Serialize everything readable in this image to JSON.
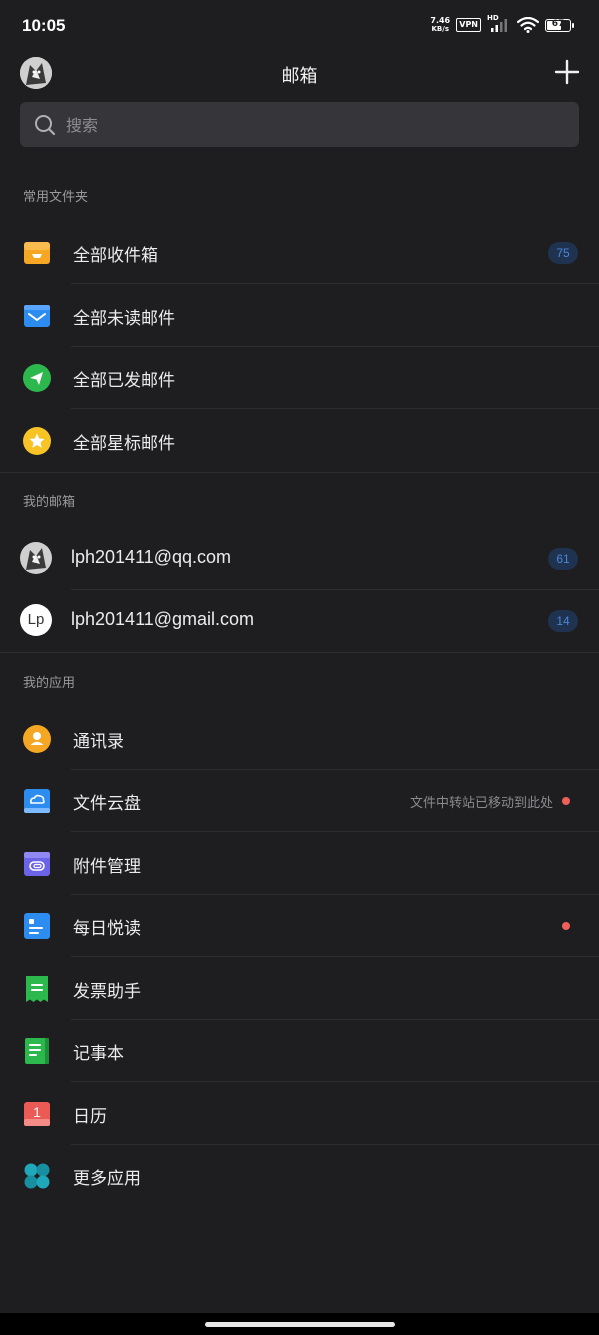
{
  "status_bar": {
    "time": "10:05",
    "net_speed_value": "7.46",
    "net_speed_unit": "KB/s",
    "vpn": "VPN",
    "hd": "HD",
    "battery": "67",
    "battery_level": 0.67
  },
  "header": {
    "title": "邮箱",
    "add_icon": "plus-icon",
    "avatar_icon": "user-avatar"
  },
  "search": {
    "placeholder": "搜索",
    "icon": "search-icon"
  },
  "sections": {
    "common_folders": "常用文件夹",
    "my_mailboxes": "我的邮箱",
    "my_apps": "我的应用"
  },
  "common_folders": [
    {
      "label": "全部收件箱",
      "icon": "inbox-icon",
      "badge": "75"
    },
    {
      "label": "全部未读邮件",
      "icon": "unread-mail-icon"
    },
    {
      "label": "全部已发邮件",
      "icon": "sent-icon"
    },
    {
      "label": "全部星标邮件",
      "icon": "star-icon"
    }
  ],
  "mailboxes": [
    {
      "label": "lph201411@qq.com",
      "badge": "61",
      "avatar": "user-avatar"
    },
    {
      "label": "lph201411@gmail.com",
      "badge": "14",
      "avatar_text": "Lp"
    }
  ],
  "apps": [
    {
      "label": "通讯录",
      "icon": "contacts-icon"
    },
    {
      "label": "文件云盘",
      "icon": "cloud-drive-icon",
      "hint": "文件中转站已移动到此处",
      "dot": true
    },
    {
      "label": "附件管理",
      "icon": "attachment-icon"
    },
    {
      "label": "每日悦读",
      "icon": "daily-read-icon",
      "dot": true
    },
    {
      "label": "发票助手",
      "icon": "invoice-icon"
    },
    {
      "label": "记事本",
      "icon": "notebook-icon"
    },
    {
      "label": "日历",
      "icon": "calendar-icon",
      "icon_text": "1"
    },
    {
      "label": "更多应用",
      "icon": "more-apps-icon"
    }
  ],
  "colors": {
    "background": "#1e1e20",
    "badge_bg": "#1f3350",
    "badge_text": "#4a86d8",
    "red_dot": "#f0605a"
  }
}
